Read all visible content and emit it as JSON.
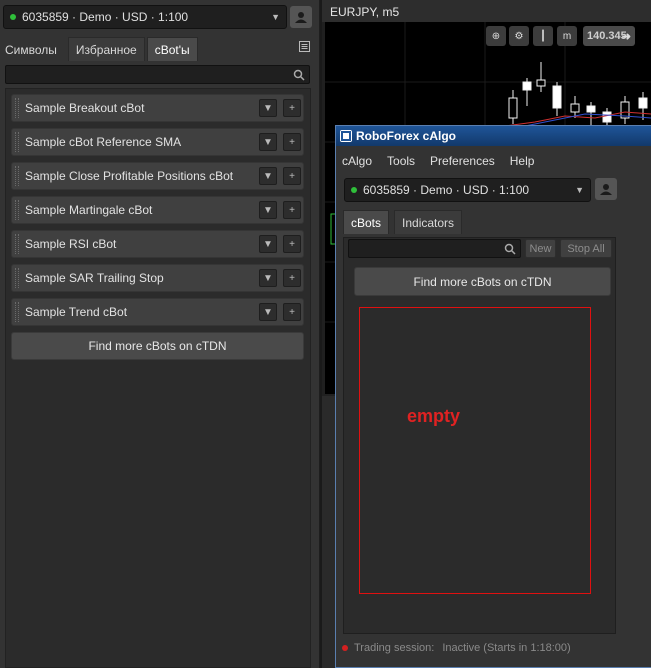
{
  "left_panel": {
    "account": "6035859 · Demo · USD · 1:100",
    "tabs": [
      {
        "label": "Символы"
      },
      {
        "label": "Избранное"
      },
      {
        "label": "cBot'ы"
      }
    ],
    "search_placeholder": "",
    "cbots": [
      {
        "name": "Sample Breakout cBot"
      },
      {
        "name": "Sample cBot Reference SMA"
      },
      {
        "name": "Sample Close Profitable Positions cBot"
      },
      {
        "name": "Sample Martingale cBot"
      },
      {
        "name": "Sample RSI cBot"
      },
      {
        "name": "Sample SAR Trailing Stop"
      },
      {
        "name": "Sample Trend cBot"
      }
    ],
    "find_more": "Find more cBots on cTDN"
  },
  "chart": {
    "title": "EURJPY, m5",
    "price": "140.345"
  },
  "calgo": {
    "title": "RoboForex cAlgo",
    "menu": [
      "cAlgo",
      "Tools",
      "Preferences",
      "Help"
    ],
    "account": "6035859 · Demo · USD · 1:100",
    "tabs": [
      {
        "label": "cBots"
      },
      {
        "label": "Indicators"
      }
    ],
    "new_button": "New",
    "stop_all_button": "Stop All",
    "find_more": "Find more cBots on cTDN",
    "empty_label": "empty",
    "status_label": "Trading session:",
    "status_value": "Inactive (Starts in 1:18:00)"
  },
  "colors": {
    "accent_connected": "#2fbf3a",
    "status_inactive": "#d42020",
    "annotation_red": "#e01010",
    "titlebar_blue": "#1f5598"
  }
}
